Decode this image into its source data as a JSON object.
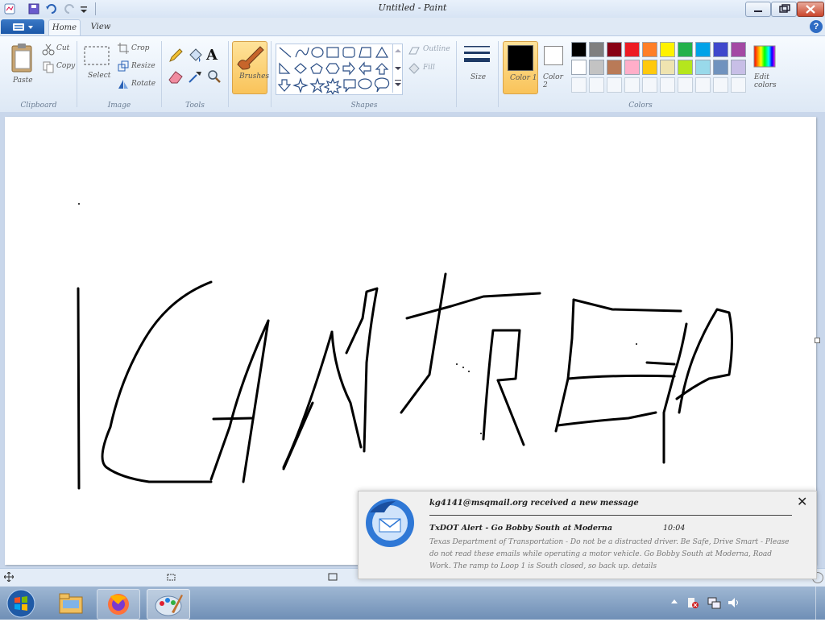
{
  "window": {
    "title": "Untitled - Paint"
  },
  "tabs": [
    {
      "label": "Home"
    },
    {
      "label": "View"
    }
  ],
  "ribbon": {
    "clipboard": {
      "paste": "Paste",
      "cut": "Cut",
      "copy": "Copy",
      "group": "Clipboard"
    },
    "image": {
      "select": "Select",
      "crop": "Crop",
      "resize": "Resize",
      "rotate": "Rotate",
      "group": "Image"
    },
    "tools": {
      "group": "Tools"
    },
    "brushes": {
      "label": "Brushes"
    },
    "shapes": {
      "outline": "Outline",
      "fill": "Fill",
      "group": "Shapes"
    },
    "size": {
      "label": "Size"
    },
    "colors": {
      "color1": "Color 1",
      "color2": "Color 2",
      "edit": "Edit colors",
      "group": "Colors"
    },
    "palette": [
      "#000000",
      "#7f7f7f",
      "#880015",
      "#ed1c24",
      "#ff7f27",
      "#fff200",
      "#22b14c",
      "#00a2e8",
      "#3f48cc",
      "#a349a4",
      "#ffffff",
      "#c3c3c3",
      "#b97a57",
      "#ffaec9",
      "#ffc90e",
      "#efe4b0",
      "#b5e61d",
      "#99d9ea",
      "#7092be",
      "#c8bfe7"
    ]
  },
  "status": {
    "cursor_pos": "+",
    "position": "",
    "selection": "",
    "size": ""
  },
  "notification": {
    "from": "kg4141@msqmail.org received a new message",
    "subject": "TxDOT Alert - Go Bobby South at Moderna",
    "time": "10:04",
    "body": "Texas Department of Transportation - Do not be a distracted driver. Be Safe, Drive Smart - Please do not read these emails while operating a motor vehicle. Go Bobby South at Moderna, Road Work. The ramp to Loop 1 is South closed, so back up. details"
  },
  "tray": {
    "time": "",
    "date": ""
  }
}
